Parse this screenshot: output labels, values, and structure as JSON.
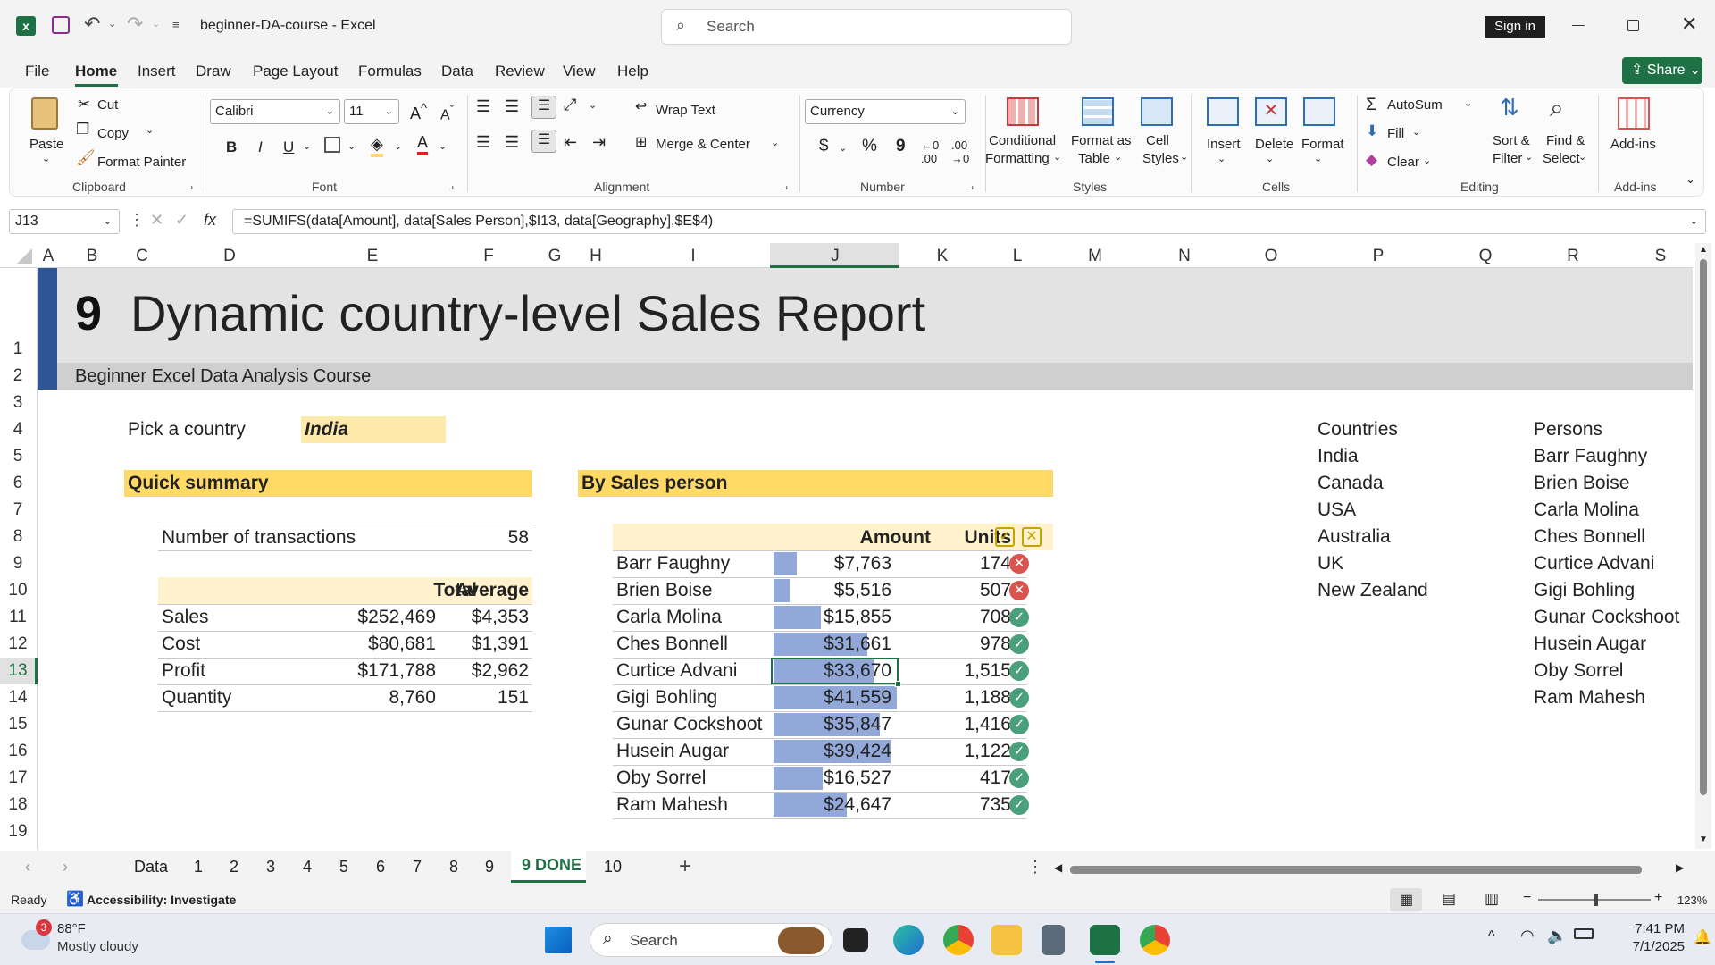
{
  "window": {
    "app_icon": "excel-icon",
    "filename": "beginner-DA-course",
    "separator": "-",
    "app_name": "Excel",
    "search_placeholder": "Search",
    "sign_in": "Sign in"
  },
  "menu": {
    "items": [
      "File",
      "Home",
      "Insert",
      "Draw",
      "Page Layout",
      "Formulas",
      "Data",
      "Review",
      "View",
      "Help"
    ],
    "share": "Share"
  },
  "ribbon": {
    "clipboard": {
      "paste": "Paste",
      "cut": "Cut",
      "copy": "Copy",
      "format_painter": "Format Painter",
      "group": "Clipboard"
    },
    "font": {
      "family": "Calibri",
      "size": "11",
      "bold": "B",
      "italic": "I",
      "underline": "U",
      "group": "Font"
    },
    "alignment": {
      "wrap_text": "Wrap Text",
      "merge_center": "Merge & Center",
      "group": "Alignment"
    },
    "number": {
      "format": "Currency",
      "currency_symbol": "$",
      "percent": "%",
      "comma": "9",
      "group": "Number"
    },
    "styles": {
      "conditional": "Conditional",
      "conditional2": "Formatting",
      "format_as": "Format as",
      "format_as2": "Table",
      "cell": "Cell",
      "cell2": "Styles",
      "group": "Styles"
    },
    "cells": {
      "insert": "Insert",
      "delete": "Delete",
      "format": "Format",
      "group": "Cells"
    },
    "editing": {
      "autosum": "AutoSum",
      "fill": "Fill",
      "clear": "Clear",
      "sort": "Sort &",
      "sort2": "Filter",
      "find": "Find &",
      "find2": "Select",
      "group": "Editing"
    },
    "addins": {
      "label": "Add-ins",
      "group": "Add-ins"
    }
  },
  "formula_bar": {
    "name_box": "J13",
    "fx": "fx",
    "formula": "=SUMIFS(data[Amount], data[Sales Person],$I13, data[Geography],$E$4)"
  },
  "columns": [
    "A",
    "B",
    "C",
    "D",
    "E",
    "F",
    "G",
    "H",
    "I",
    "J",
    "K",
    "L",
    "M",
    "N",
    "O",
    "P",
    "Q",
    "R",
    "S"
  ],
  "rows": [
    "1",
    "2",
    "3",
    "4",
    "5",
    "6",
    "7",
    "8",
    "9",
    "10",
    "11",
    "12",
    "13",
    "14",
    "15",
    "16",
    "17",
    "18",
    "19"
  ],
  "sheet": {
    "title_number": "9",
    "title": "Dynamic country-level Sales Report",
    "subtitle": "Beginner Excel Data Analysis Course",
    "pick_label": "Pick a country",
    "pick_value": "India",
    "quick_summary": "Quick summary",
    "by_sales_person": "By Sales person",
    "num_tx_label": "Number of transactions",
    "num_tx_value": "58",
    "summary_headers": {
      "total": "Total",
      "average": "Average"
    },
    "summary_rows": [
      {
        "label": "Sales",
        "total": "$252,469",
        "avg": "$4,353"
      },
      {
        "label": "Cost",
        "total": "$80,681",
        "avg": "$1,391"
      },
      {
        "label": "Profit",
        "total": "$171,788",
        "avg": "$2,962"
      },
      {
        "label": "Quantity",
        "total": "8,760",
        "avg": "151"
      }
    ],
    "sp_headers": {
      "amount": "Amount",
      "units": "Units"
    },
    "persons_table": [
      {
        "name": "Barr Faughny",
        "amount": "$7,763",
        "units": "174",
        "status": "cross",
        "bar_fraction": 0.187
      },
      {
        "name": "Brien Boise",
        "amount": "$5,516",
        "units": "507",
        "status": "cross",
        "bar_fraction": 0.133
      },
      {
        "name": "Carla Molina",
        "amount": "$15,855",
        "units": "708",
        "status": "check",
        "bar_fraction": 0.381
      },
      {
        "name": "Ches Bonnell",
        "amount": "$31,661",
        "units": "978",
        "status": "check",
        "bar_fraction": 0.762
      },
      {
        "name": "Curtice Advani",
        "amount": "$33,670",
        "units": "1,515",
        "status": "check",
        "bar_fraction": 0.81
      },
      {
        "name": "Gigi Bohling",
        "amount": "$41,559",
        "units": "1,188",
        "status": "check",
        "bar_fraction": 1.0
      },
      {
        "name": "Gunar Cockshoot",
        "amount": "$35,847",
        "units": "1,416",
        "status": "check",
        "bar_fraction": 0.863
      },
      {
        "name": "Husein Augar",
        "amount": "$39,424",
        "units": "1,122",
        "status": "check",
        "bar_fraction": 0.949
      },
      {
        "name": "Oby Sorrel",
        "amount": "$16,527",
        "units": "417",
        "status": "check",
        "bar_fraction": 0.398
      },
      {
        "name": "Ram Mahesh",
        "amount": "$24,647",
        "units": "735",
        "status": "check",
        "bar_fraction": 0.593
      }
    ],
    "countries_header": "Countries",
    "countries": [
      "India",
      "Canada",
      "USA",
      "Australia",
      "UK",
      "New Zealand"
    ],
    "persons_header": "Persons",
    "persons": [
      "Barr Faughny",
      "Brien Boise",
      "Carla Molina",
      "Ches Bonnell",
      "Curtice Advani",
      "Gigi Bohling",
      "Gunar Cockshoot",
      "Husein Augar",
      "Oby Sorrel",
      "Ram Mahesh"
    ]
  },
  "sheet_tabs": [
    "Data",
    "1",
    "2",
    "3",
    "4",
    "5",
    "6",
    "7",
    "8",
    "9",
    "9 DONE",
    "10"
  ],
  "status": {
    "ready": "Ready",
    "accessibility": "Accessibility: Investigate",
    "zoom": "123%"
  },
  "taskbar": {
    "weather_badge": "3",
    "temp": "88°F",
    "condition": "Mostly cloudy",
    "search": "Search",
    "time": "7:41 PM",
    "date": "7/1/2025"
  },
  "colors": {
    "accent_green": "#1e7145",
    "yellow_header": "#ffd966",
    "bar_blue": "#92a8d8",
    "title_band": "#2f5597"
  }
}
